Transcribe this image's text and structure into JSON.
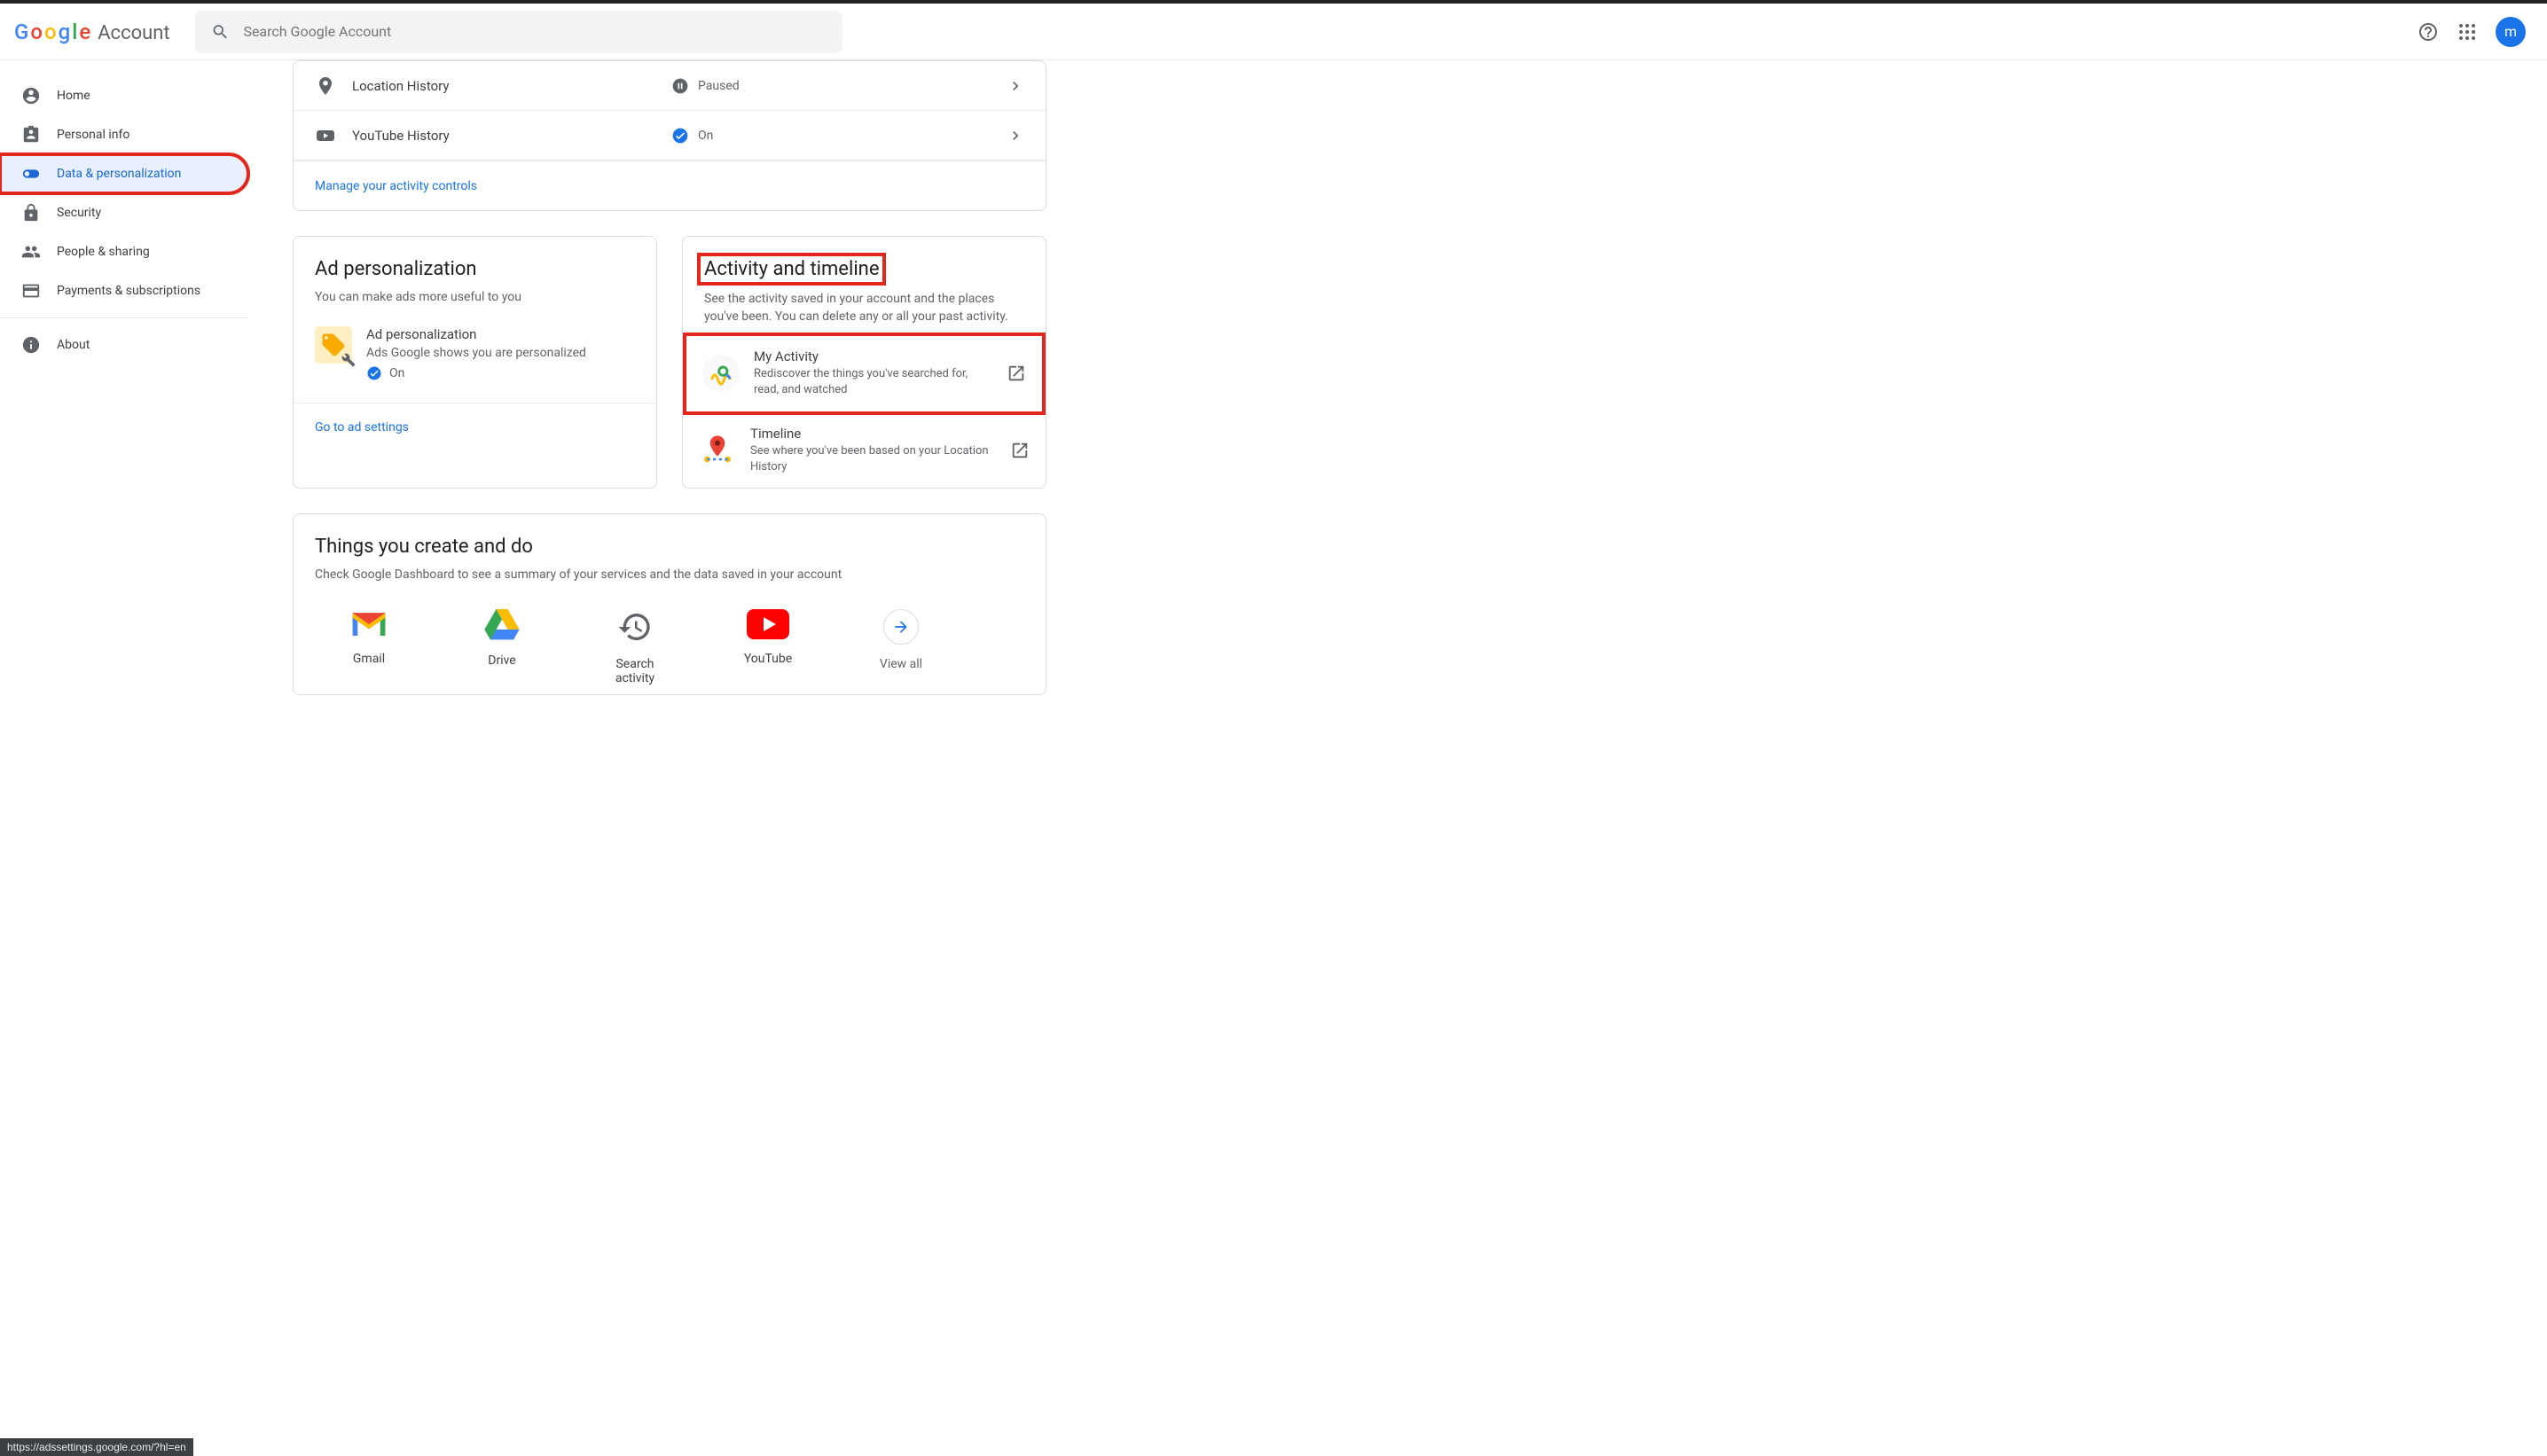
{
  "header": {
    "product": "Account",
    "search_placeholder": "Search Google Account",
    "avatar_initial": "m"
  },
  "sidebar": {
    "items": [
      {
        "label": "Home"
      },
      {
        "label": "Personal info"
      },
      {
        "label": "Data & personalization"
      },
      {
        "label": "Security"
      },
      {
        "label": "People & sharing"
      },
      {
        "label": "Payments & subscriptions"
      },
      {
        "label": "About"
      }
    ]
  },
  "activity_controls": {
    "rows": [
      {
        "label": "Location History",
        "status": "Paused"
      },
      {
        "label": "YouTube History",
        "status": "On"
      }
    ],
    "manage_link": "Manage your activity controls"
  },
  "ad_personalization": {
    "title": "Ad personalization",
    "sub": "You can make ads more useful to you",
    "item_title": "Ad personalization",
    "item_sub": "Ads Google shows you are personalized",
    "status": "On",
    "link": "Go to ad settings"
  },
  "activity_timeline": {
    "title": "Activity and timeline",
    "sub": "See the activity saved in your account and the places you've been. You can delete any or all your past activity.",
    "items": [
      {
        "title": "My Activity",
        "sub": "Rediscover the things you've searched for, read, and watched"
      },
      {
        "title": "Timeline",
        "sub": "See where you've been based on your Location History"
      }
    ]
  },
  "things": {
    "title": "Things you create and do",
    "sub": "Check Google Dashboard to see a summary of your services and the data saved in your account",
    "items": [
      {
        "label": "Gmail"
      },
      {
        "label": "Drive"
      },
      {
        "label": "Search activity"
      },
      {
        "label": "YouTube"
      }
    ],
    "view_all": "View all"
  },
  "status_url": "https://adssettings.google.com/?hl=en"
}
